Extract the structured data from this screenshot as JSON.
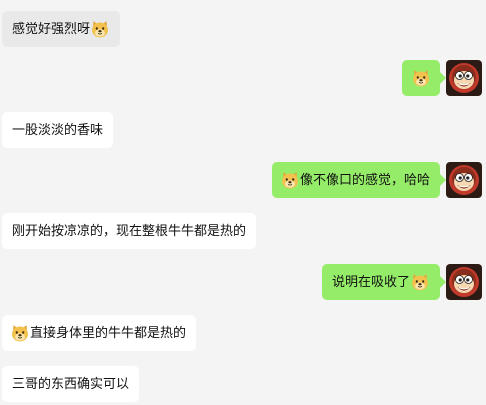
{
  "messages": [
    {
      "side": "in",
      "text": "感觉好强烈呀",
      "emoji": "doge-emoji-after"
    },
    {
      "side": "out",
      "text": "",
      "emoji": "doge-emoji-only"
    },
    {
      "side": "in",
      "text": "一股淡淡的香味"
    },
    {
      "side": "out",
      "text": "像不像口的感觉，哈哈",
      "emoji": "doge-emoji-before"
    },
    {
      "side": "in",
      "text": "刚开始按凉凉的，现在整根牛牛都是热的"
    },
    {
      "side": "out",
      "text": "说明在吸收了",
      "emoji": "doge-emoji-after"
    },
    {
      "side": "in",
      "text": "直接身体里的牛牛都是热的",
      "emoji": "doge-emoji-before"
    },
    {
      "side": "in",
      "text": "三哥的东西确实可以"
    }
  ],
  "colors": {
    "background": "#f4f4f4",
    "incoming_bubble": "#ffffff",
    "outgoing_bubble": "#95ec69",
    "doge": "#f2c14e"
  },
  "icons": {
    "emoji": "doge-face-icon",
    "avatar": "cartoon-monkey-avatar-icon"
  }
}
